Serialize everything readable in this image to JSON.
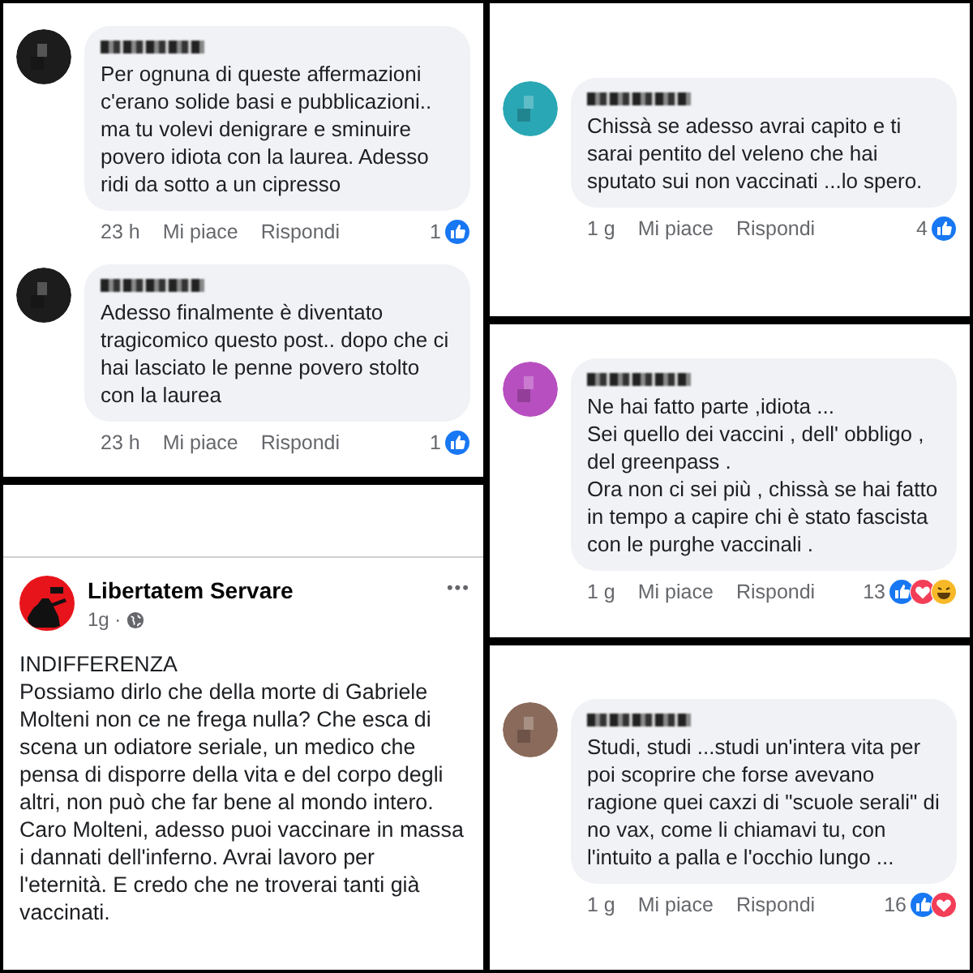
{
  "panels": [
    {
      "kind": "comments",
      "comments": [
        {
          "avatar": {
            "color": "#1c1c1c"
          },
          "text": "Per ognuna di queste affermazioni c'erano solide basi e pubblicazioni.. ma tu volevi denigrare e sminuire povero idiota con la laurea. Adesso ridi da sotto a un cipresso",
          "time": "23 h",
          "like": "Mi piace",
          "reply": "Rispondi",
          "count": "1",
          "reactions": [
            {
              "kind": "like"
            }
          ]
        },
        {
          "avatar": {
            "color": "#1c1c1c"
          },
          "text": "Adesso finalmente è diventato tragicomico questo post.. dopo che ci hai lasciato le penne povero stolto con la laurea",
          "time": "23 h",
          "like": "Mi piace",
          "reply": "Rispondi",
          "count": "1",
          "reactions": [
            {
              "kind": "like"
            }
          ]
        }
      ]
    },
    {
      "kind": "post",
      "author": "Libertatem Servare",
      "time": "1g ·",
      "menu": "•••",
      "title": "INDIFFERENZA",
      "text": "Possiamo dirlo che della morte di Gabriele Molteni non ce ne frega nulla? Che esca di scena un odiatore seriale, un medico che pensa di disporre della vita e del corpo degli altri, non può che far bene al mondo intero. Caro Molteni, adesso puoi vaccinare in massa i dannati dell'inferno. Avrai lavoro per l'eternità. E credo che ne troverai tanti già vaccinati."
    },
    {
      "kind": "comments",
      "comments": [
        {
          "avatar": {
            "color": "#2aa7b5"
          },
          "text": "Chissà se adesso avrai capito e ti sarai pentito del veleno che hai sputato sui non vaccinati ...lo spero.",
          "time": "1 g",
          "like": "Mi piace",
          "reply": "Rispondi",
          "count": "4",
          "reactions": [
            {
              "kind": "like"
            }
          ]
        }
      ]
    },
    {
      "kind": "comments",
      "comments": [
        {
          "avatar": {
            "color": "#b84fc0"
          },
          "text": "Ne hai fatto parte ,idiota ...\nSei quello dei vaccini , dell' obbligo , del greenpass .\nOra non ci sei più , chissà se hai fatto in tempo a capire chi è stato fascista con le purghe vaccinali .",
          "time": "1 g",
          "like": "Mi piace",
          "reply": "Rispondi",
          "count": "13",
          "reactions": [
            {
              "kind": "like"
            },
            {
              "kind": "love"
            },
            {
              "kind": "haha"
            }
          ]
        }
      ]
    },
    {
      "kind": "comments",
      "comments": [
        {
          "avatar": {
            "color": "#8a6a5a"
          },
          "text": "Studi, studi ...studi un'intera vita per poi scoprire che forse avevano ragione quei caxzi di \"scuole serali\" di no vax, come li chiamavi tu,  con l'intuito a palla e l'occhio lungo ...",
          "time": "1 g",
          "like": "Mi piace",
          "reply": "Rispondi",
          "count": "16",
          "reactions": [
            {
              "kind": "like"
            },
            {
              "kind": "love"
            }
          ]
        }
      ]
    }
  ]
}
